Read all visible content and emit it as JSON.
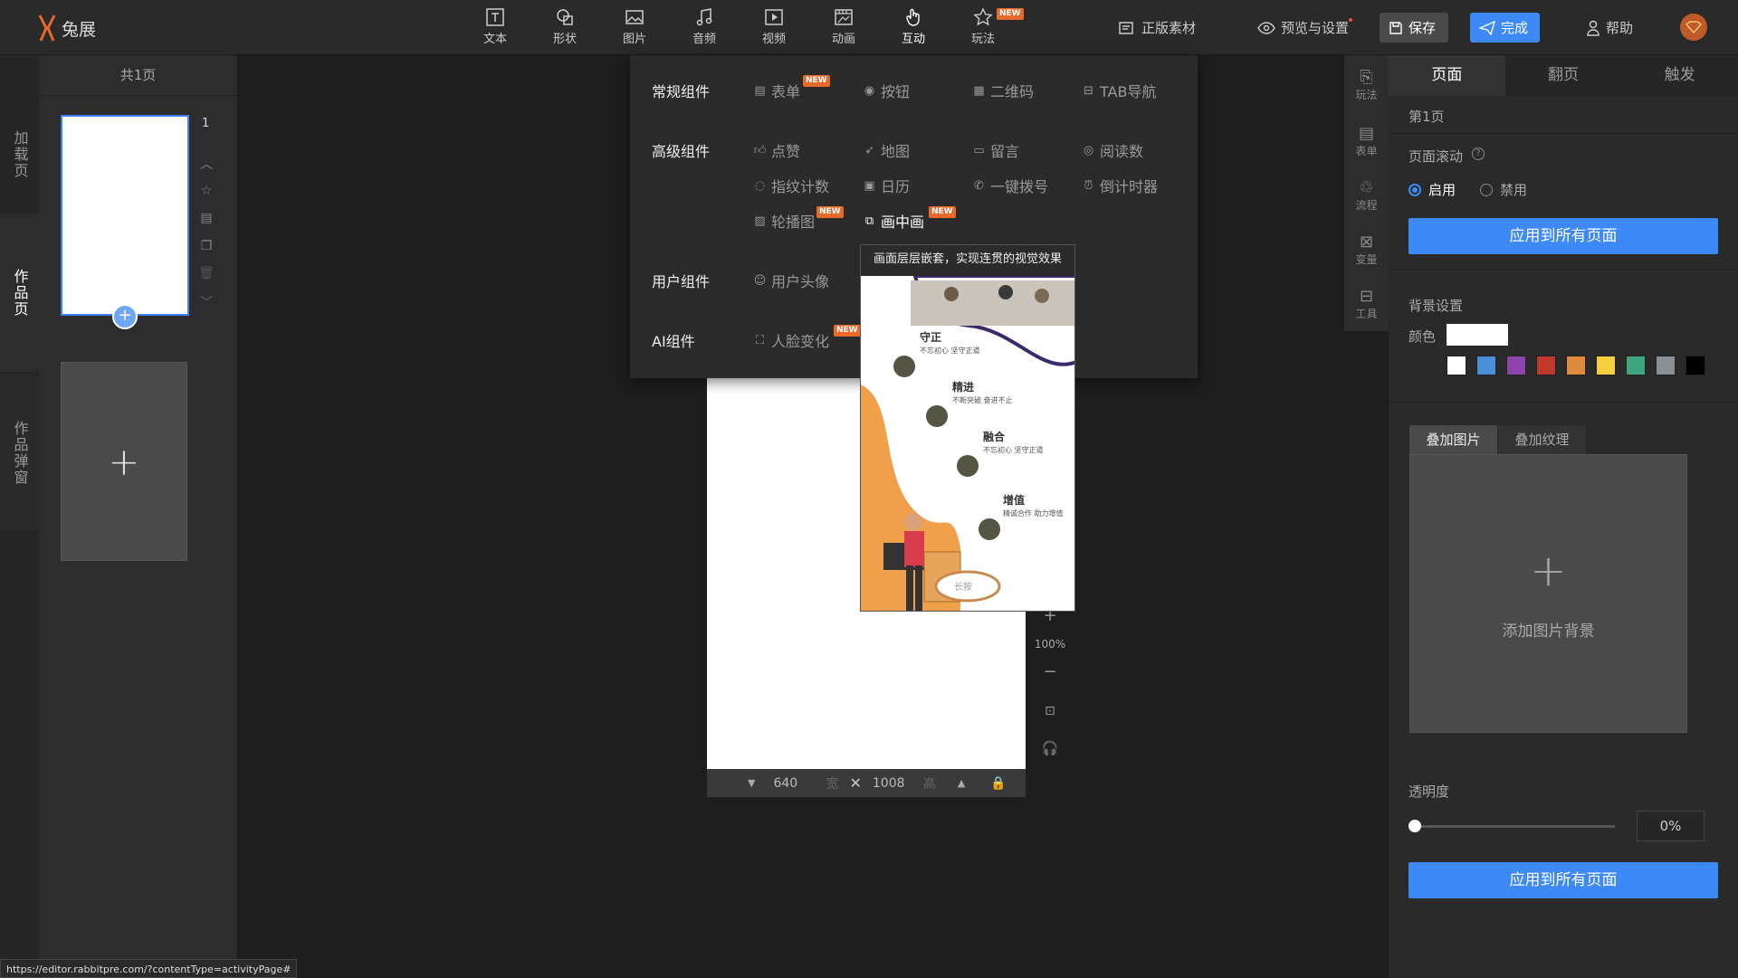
{
  "app": {
    "logo_text": "兔展"
  },
  "toolbar": {
    "tools": [
      {
        "label": "文本",
        "icon": "text-icon"
      },
      {
        "label": "形状",
        "icon": "shape-icon"
      },
      {
        "label": "图片",
        "icon": "image-icon"
      },
      {
        "label": "音频",
        "icon": "music-icon"
      },
      {
        "label": "视频",
        "icon": "video-icon"
      },
      {
        "label": "动画",
        "icon": "animation-icon"
      },
      {
        "label": "互动",
        "icon": "hand-icon"
      },
      {
        "label": "玩法",
        "icon": "star-icon",
        "badge": "NEW"
      }
    ],
    "genuine_material": "正版素材",
    "preview_settings": "预览与设置",
    "save": "保存",
    "done": "完成",
    "help": "帮助"
  },
  "left_tabs": [
    "加载页",
    "作品页",
    "作品弹窗"
  ],
  "pages": {
    "header": "共1页",
    "page_number": "1"
  },
  "dropdown": {
    "categories": {
      "regular": "常规组件",
      "advanced": "高级组件",
      "user": "用户组件",
      "ai": "AI组件"
    },
    "regular_items": [
      {
        "label": "表单",
        "badge": "NEW"
      },
      {
        "label": "按钮"
      },
      {
        "label": "二维码"
      },
      {
        "label": "TAB导航"
      }
    ],
    "advanced_items": [
      {
        "label": "点赞"
      },
      {
        "label": "地图"
      },
      {
        "label": "留言"
      },
      {
        "label": "阅读数"
      },
      {
        "label": "指纹计数"
      },
      {
        "label": "日历"
      },
      {
        "label": "一键拨号"
      },
      {
        "label": "倒计时器"
      },
      {
        "label": "轮播图",
        "badge": "NEW"
      },
      {
        "label": "画中画",
        "badge": "NEW"
      }
    ],
    "user_items": [
      {
        "label": "用户头像"
      }
    ],
    "ai_items": [
      {
        "label": "人脸变化",
        "badge": "NEW"
      }
    ]
  },
  "preview": {
    "title": "画面层层嵌套，实现连贯的视觉效果",
    "entries": [
      {
        "title": "守正",
        "sub": "不忘初心 坚守正道"
      },
      {
        "title": "精进",
        "sub": "不断突破 奋进不止"
      },
      {
        "title": "融合",
        "sub": "不忘初心 坚守正道"
      },
      {
        "title": "增值",
        "sub": "精诚合作 助力增值"
      }
    ],
    "press_label": "长按"
  },
  "canvas": {
    "width_value": "640",
    "width_label": "宽",
    "height_value": "1008",
    "height_label": "高",
    "zoom": "100%"
  },
  "right_tools": [
    "玩法",
    "表单",
    "流程",
    "变量",
    "工具"
  ],
  "right_panel": {
    "tabs": [
      "页面",
      "翻页",
      "触发"
    ],
    "page_title": "第1页",
    "scroll_label": "页面滚动",
    "radio_on": "启用",
    "radio_off": "禁用",
    "apply_all": "应用到所有页面",
    "bg_settings": "背景设置",
    "color_label": "颜色",
    "swatches": [
      "#ffffff",
      "#4a90d9",
      "#8e44ad",
      "#c0392b",
      "#e08a3c",
      "#f4d03f",
      "#3ea57e",
      "#8a8f94",
      "#000000"
    ],
    "overlay_tabs": [
      "叠加图片",
      "叠加纹理"
    ],
    "add_bg": "添加图片背景",
    "opacity_label": "透明度",
    "opacity_value": "0%",
    "apply_all_2": "应用到所有页面"
  },
  "status_url": "https://editor.rabbitpre.com/?contentType=activityPage#"
}
